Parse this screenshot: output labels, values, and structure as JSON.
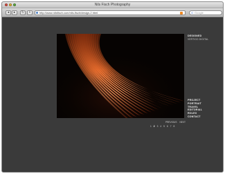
{
  "window": {
    "title": "Nils Fisch Photography"
  },
  "toolbar": {
    "back_icon": "back-arrow",
    "forward_icon": "forward-arrow",
    "reload_icon": "reload",
    "add_icon": "plus",
    "url": "http://www.nilsfisch.com/nils-fisch/design-2.html",
    "search_placeholder": "Google"
  },
  "brand": {
    "title": "DESIGNED",
    "subtitle": "VERTIGO DIGITAL"
  },
  "menu": {
    "items": [
      "PROJECT",
      "PORTRAIT",
      "TRAVEL",
      "EDITORIAL",
      "ROLEX",
      "CONTACT"
    ]
  },
  "pager": {
    "previous": "PREVIOUS",
    "next": "NEXT",
    "pages": [
      "1",
      "2",
      "3",
      "4",
      "5",
      "6",
      "7",
      "8"
    ],
    "current": "2"
  },
  "colors": {
    "page_background": "#3a3a3a",
    "photo_orange": "#e06a2c",
    "photo_background": "#060302"
  }
}
